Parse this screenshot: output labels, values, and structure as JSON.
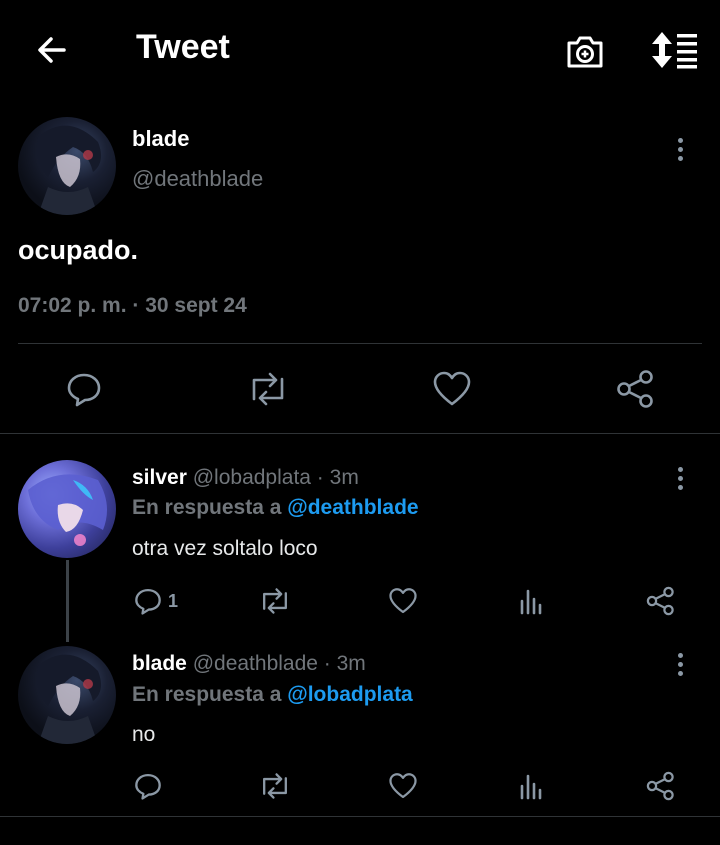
{
  "header": {
    "title": "Tweet"
  },
  "tweet": {
    "name": "blade",
    "handle": "@deathblade",
    "text": "ocupado.",
    "meta": "07:02 p. m. · 30 sept 24"
  },
  "replies": [
    {
      "name": "silver",
      "handle_time": "@lobadplata · 3m",
      "reply_prefix": "En respuesta a",
      "reply_to": "@deathblade",
      "text": "otra vez soltalo loco",
      "reply_count": "1"
    },
    {
      "name": "blade",
      "handle_time": "@deathblade · 3m",
      "reply_prefix": "En respuesta a",
      "reply_to": "@lobadplata",
      "text": "no",
      "reply_count": ""
    }
  ],
  "icons": {
    "back": "arrow-left-icon",
    "camera": "camera-icon",
    "sort": "sort-icon",
    "reply": "reply-icon",
    "retweet": "retweet-icon",
    "like": "heart-icon",
    "share": "share-icon",
    "stats": "stats-icon",
    "more": "more-icon"
  },
  "colors": {
    "background": "#000000",
    "accent": "#1d9bf0",
    "muted": "#71767b"
  }
}
